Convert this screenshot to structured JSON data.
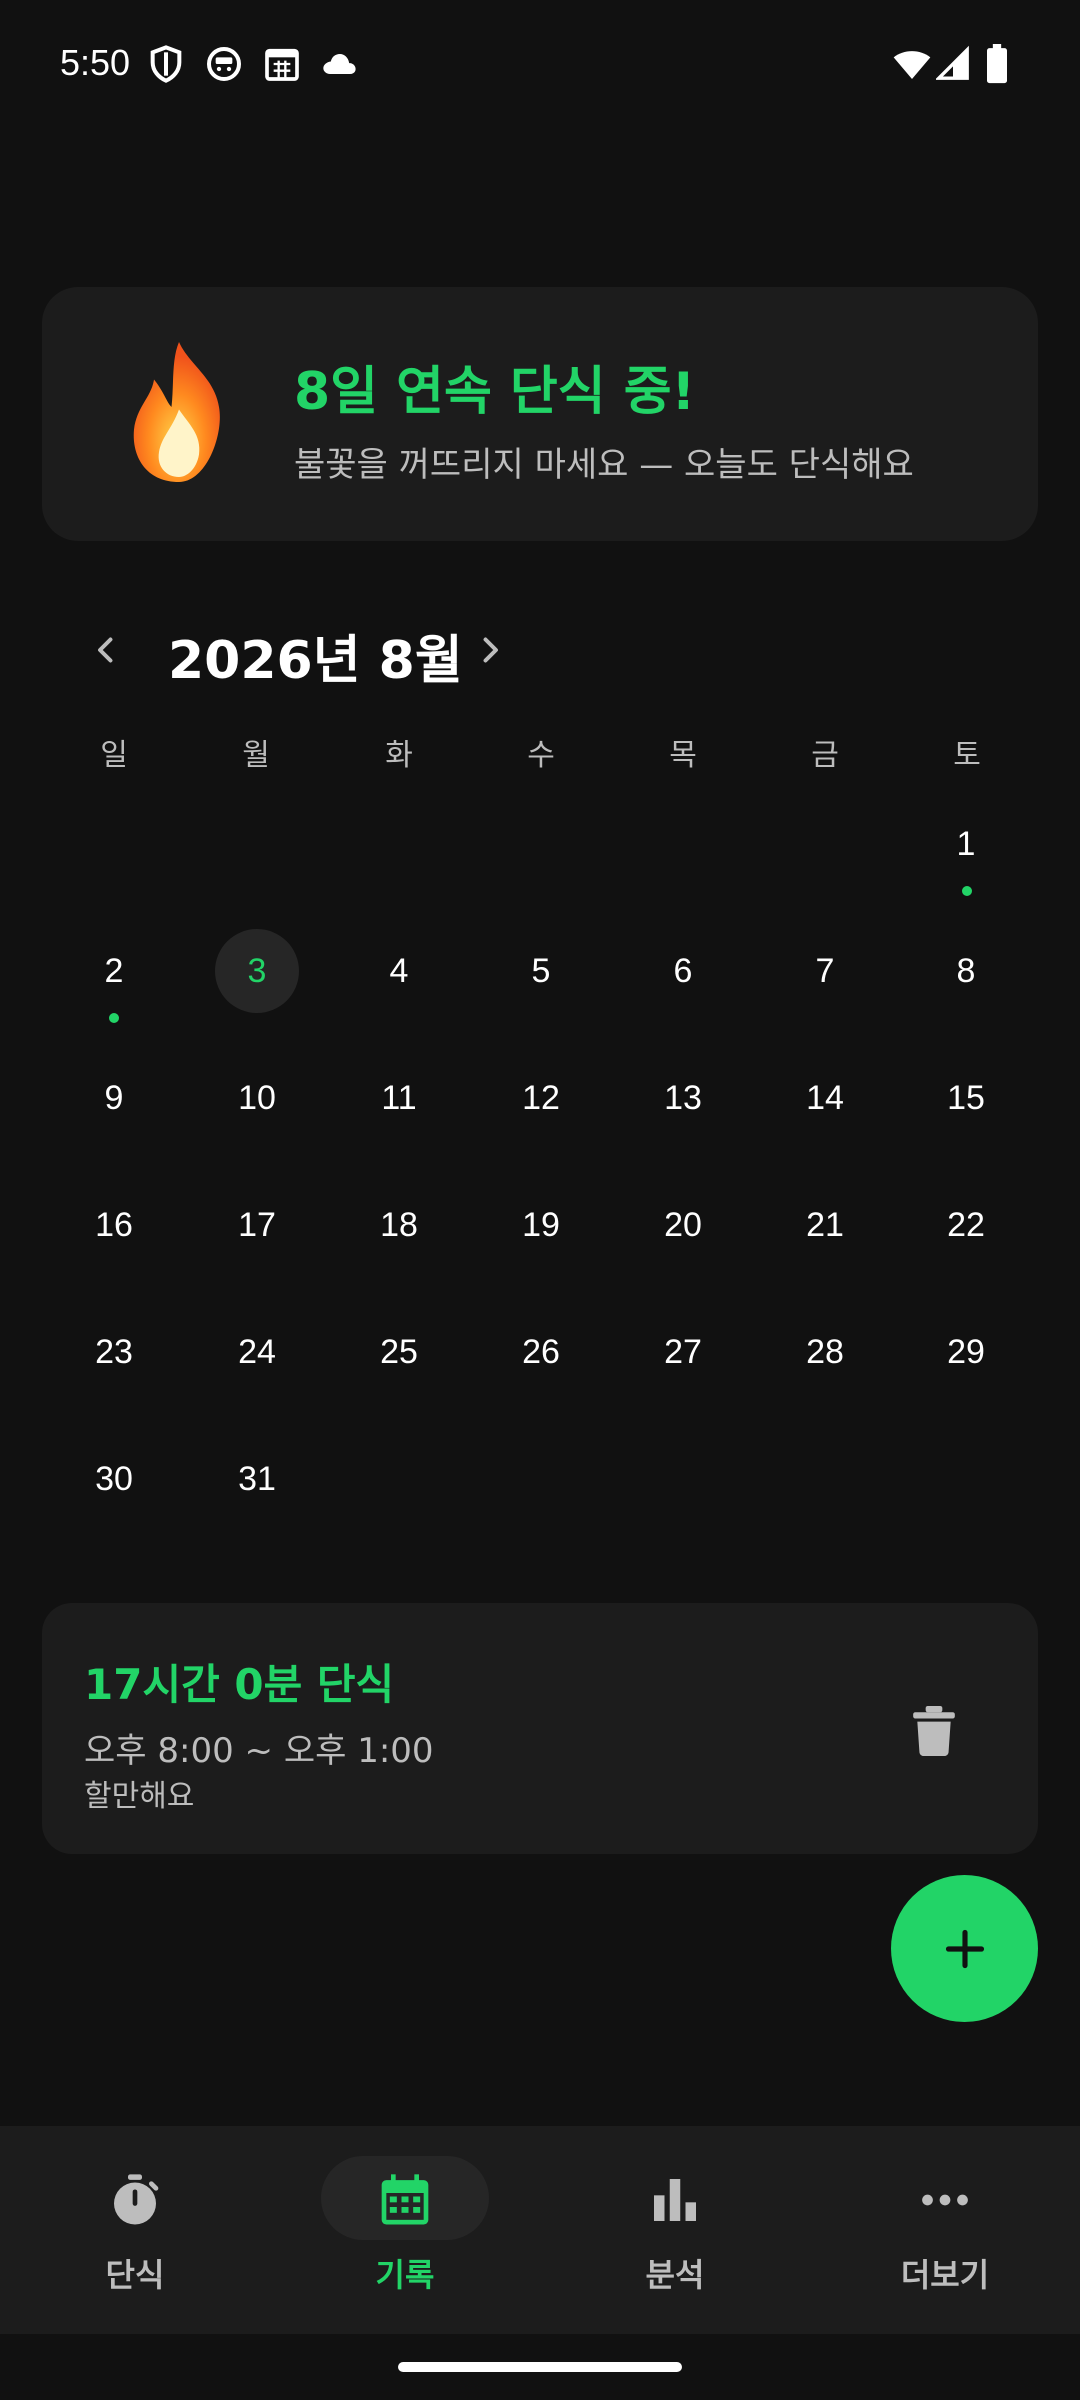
{
  "status_bar": {
    "time": "5:50",
    "icons": [
      "shield-icon",
      "face-icon",
      "calendar-icon",
      "cloud-icon",
      "wifi-icon",
      "signal-icon",
      "battery-icon"
    ]
  },
  "streak": {
    "icon": "fire-icon",
    "title": "8일 연속 단식 중!",
    "subtitle": "불꽃을 꺼뜨리지 마세요 — 오늘도 단식해요"
  },
  "calendar": {
    "month_title": "2026년 8월",
    "prev_icon": "chevron-left-icon",
    "next_icon": "chevron-right-icon",
    "weekdays": [
      "일",
      "월",
      "화",
      "수",
      "목",
      "금",
      "토"
    ],
    "selected_day": "3",
    "days_with_records": [
      "1",
      "2"
    ],
    "days": [
      "1",
      "2",
      "3",
      "4",
      "5",
      "6",
      "7",
      "8",
      "9",
      "10",
      "11",
      "12",
      "13",
      "14",
      "15",
      "16",
      "17",
      "18",
      "19",
      "20",
      "21",
      "22",
      "23",
      "24",
      "25",
      "26",
      "27",
      "28",
      "29",
      "30",
      "31"
    ]
  },
  "record": {
    "title": "17시간 0분 단식",
    "time_range": "오후 8:00 ~ 오후 1:00",
    "note": "할만해요",
    "delete_icon": "trash-icon"
  },
  "fab": {
    "icon": "plus-icon"
  },
  "bottom_nav": {
    "items": [
      {
        "label": "단식",
        "icon": "timer-icon",
        "active": false
      },
      {
        "label": "기록",
        "icon": "calendar-icon",
        "active": true
      },
      {
        "label": "분석",
        "icon": "bar-chart-icon",
        "active": false
      },
      {
        "label": "더보기",
        "icon": "more-icon",
        "active": false
      }
    ]
  },
  "colors": {
    "background": "#111111",
    "card": "#1c1c1c",
    "accent": "#22d467",
    "muted_text": "#bdbdbd"
  }
}
